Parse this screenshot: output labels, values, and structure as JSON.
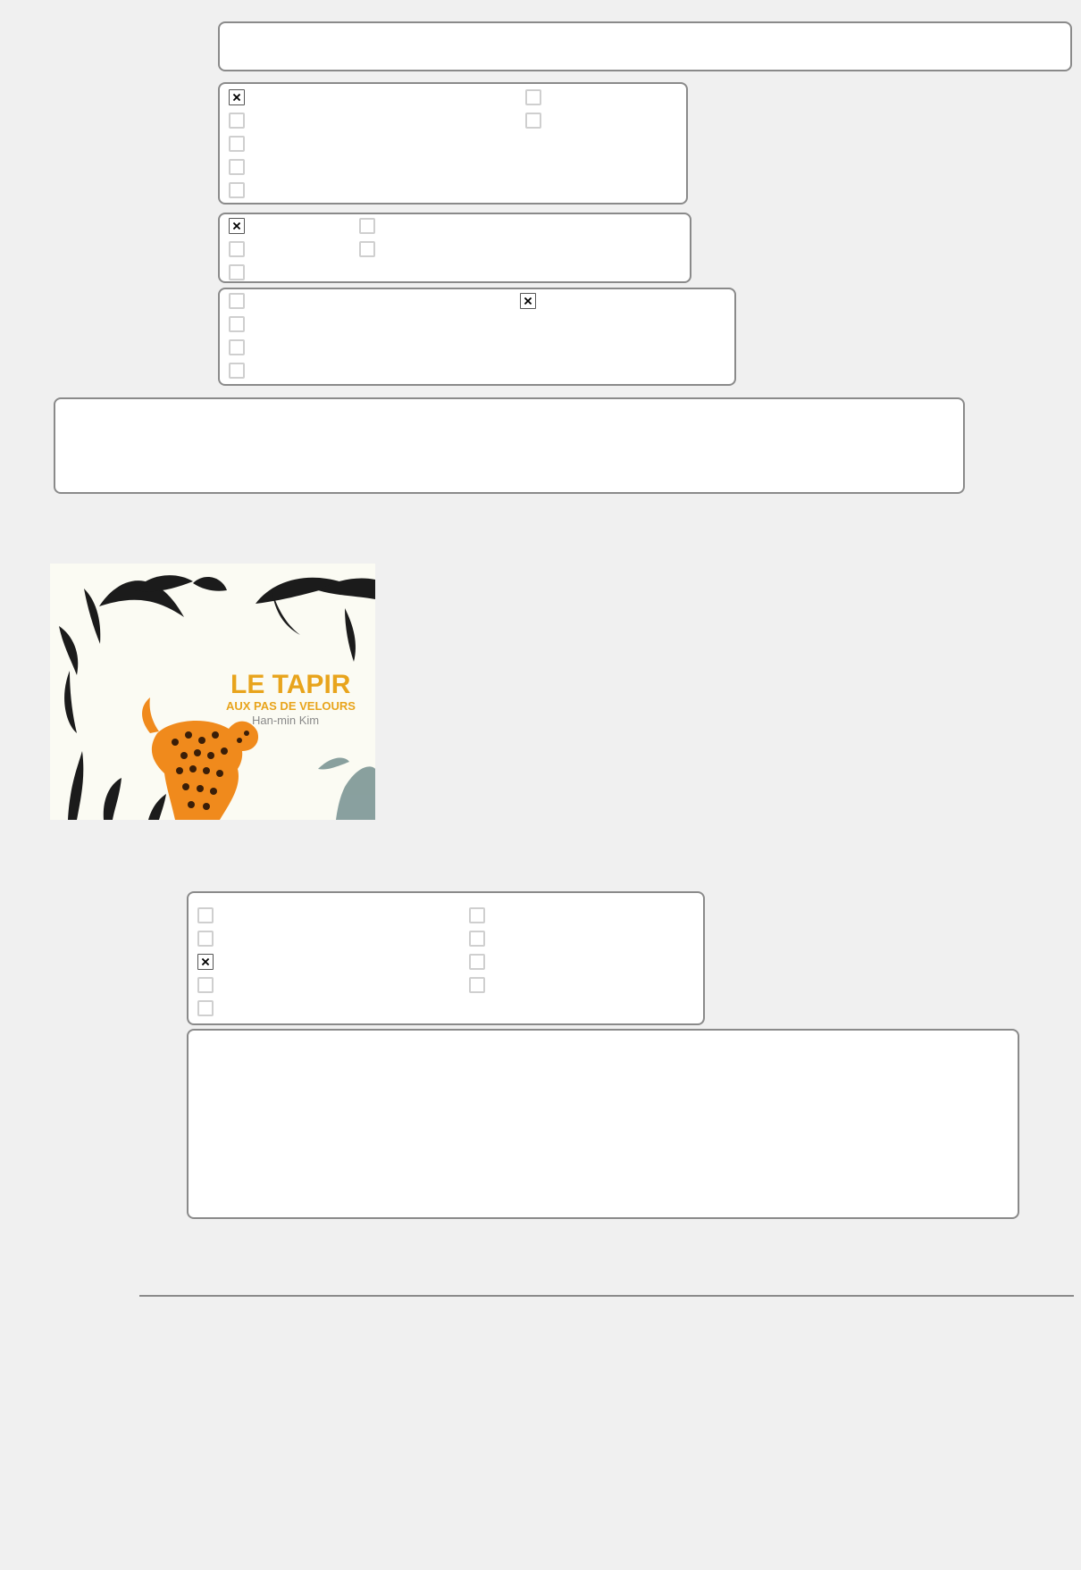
{
  "form": {
    "q1_checked": [
      true,
      false,
      false,
      false,
      false,
      false,
      false
    ],
    "q2_checked": [
      true,
      false,
      false,
      false,
      false
    ],
    "q3_checked": [
      false,
      false,
      false,
      false,
      true
    ],
    "q4_checked": [
      false,
      false,
      true,
      false,
      false,
      false,
      false,
      false,
      false
    ]
  },
  "book_cover": {
    "title": "LE TAPIR",
    "subtitle": "AUX PAS DE VELOURS",
    "author": "Han-min Kim",
    "title_color": "#e8a41c",
    "author_color": "#8a8a8a"
  }
}
